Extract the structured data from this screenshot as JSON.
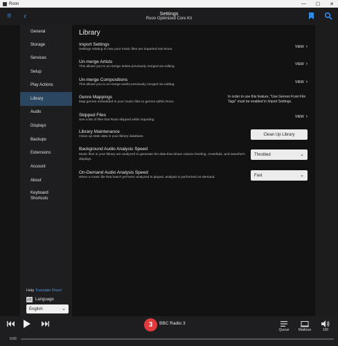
{
  "window": {
    "title": "Roon",
    "minimize": "—",
    "maximize": "☐",
    "close": "✕"
  },
  "header": {
    "title": "Settings",
    "subtitle": "Roon Optimized Core Kit",
    "menu_icon": "≡",
    "back_icon": "‹"
  },
  "sidebar": {
    "items": [
      {
        "label": "General",
        "active": false
      },
      {
        "label": "Storage",
        "active": false
      },
      {
        "label": "Services",
        "active": false
      },
      {
        "label": "Setup",
        "active": false
      },
      {
        "label": "Play Actions",
        "active": false
      },
      {
        "label": "Library",
        "active": true
      },
      {
        "label": "Audio",
        "active": false
      },
      {
        "label": "Displays",
        "active": false
      },
      {
        "label": "Backups",
        "active": false
      },
      {
        "label": "Extensions",
        "active": false
      },
      {
        "label": "Account",
        "active": false
      },
      {
        "label": "About",
        "active": false
      },
      {
        "label": "Keyboard\nShortcuts",
        "active": false
      }
    ],
    "help_label": "Help",
    "help_link": "Translate Roon!",
    "language_label": "Language",
    "language_icon_text": "A文",
    "language_value": "English"
  },
  "main": {
    "title": "Library",
    "settings": [
      {
        "title": "Import Settings",
        "desc": "Settings relating to how your music files are imported into Roon.",
        "action": "VIEW"
      },
      {
        "title": "Un-merge Artists",
        "desc": "This allows you to un-merge artists previously merged via editing.",
        "action": "VIEW"
      },
      {
        "title": "Un-merge Compositions",
        "desc": "This allows you to un-merge works previously merged via editing.",
        "action": "VIEW"
      },
      {
        "title": "Genre Mappings",
        "desc": "Map genres embedded in your music files to genres within Roon.",
        "note": "In order to use this feature, \"Use Genres From File Tags\" must be enabled in Import Settings."
      },
      {
        "title": "Skipped Files",
        "desc": "See a list of files that Roon skipped while importing.",
        "action": "VIEW"
      },
      {
        "title": "Library Maintenance",
        "desc": "Clean up stale data in your library database.",
        "button": "Clean Up Library"
      },
      {
        "title": "Background Audio Analysis Speed",
        "desc": "Music files in your library are analyzed to generate the data that drives volume leveling, crossfade, and waveform displays.",
        "select": "Throttled"
      },
      {
        "title": "On-Demand Audio Analysis Speed",
        "desc": "When a music file that hasn't yet been analyzed is played, analysis is performed on-demand.",
        "select": "Fast"
      }
    ]
  },
  "player": {
    "station": "BBC Radio 3",
    "station_logo_text": "3",
    "queue_label": "Queue",
    "zone_label": "Mattisse",
    "volume_label": "100",
    "time": "0:00",
    "progress": 0
  },
  "colors": {
    "accent": "#2e8be6",
    "active_nav": "#2a4661",
    "bbc_red": "#e03a3e"
  }
}
